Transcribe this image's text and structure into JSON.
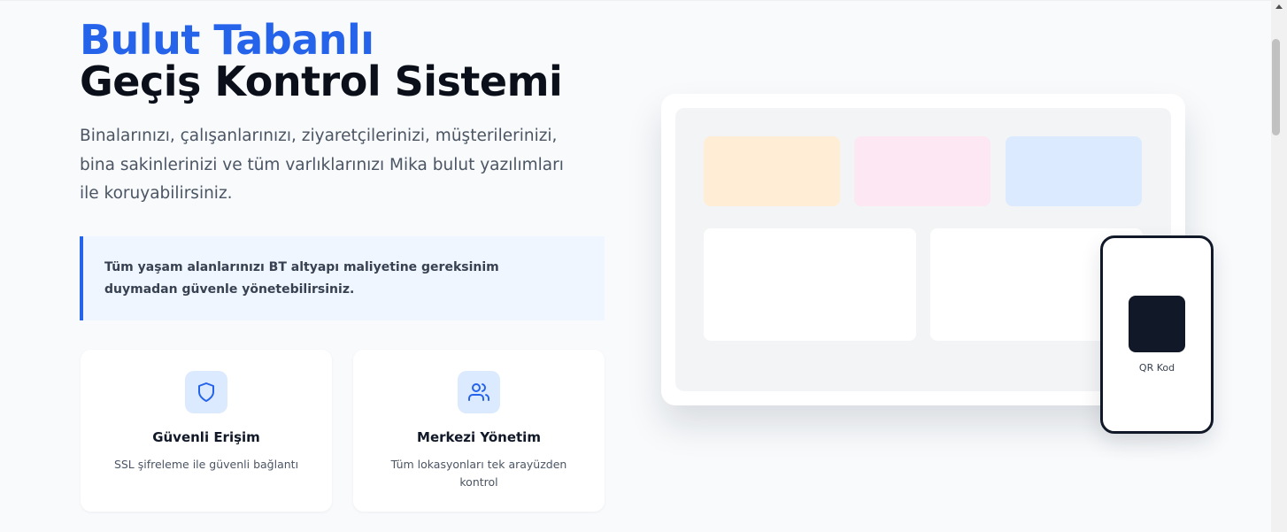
{
  "hero": {
    "title_line1": "Bulut Tabanlı",
    "title_line2": "Geçiş Kontrol Sistemi",
    "description": "Binalarınızı, çalışanlarınızı, ziyaretçilerinizi, müşterilerinizi, bina sakinlerinizi ve tüm varlıklarınızı Mika bulut yazılımları ile koruyabilirsiniz.",
    "callout": "Tüm yaşam alanlarınızı BT altyapı maliyetine gereksinim duymadan güvenle yönetebilirsiniz."
  },
  "features": [
    {
      "icon": "shield-icon",
      "title": "Güvenli Erişim",
      "description": "SSL şifreleme ile güvenli bağlantı"
    },
    {
      "icon": "users-icon",
      "title": "Merkezi Yönetim",
      "description": "Tüm lokasyonları tek arayüzden kontrol"
    }
  ],
  "mockup": {
    "tile_colors": [
      "#ffedd5",
      "#fce7f3",
      "#dbeafe"
    ],
    "phone_label": "QR Kod"
  },
  "colors": {
    "accent": "#2563eb",
    "icon_background": "#dbeafe",
    "callout_background": "#eff6ff"
  }
}
